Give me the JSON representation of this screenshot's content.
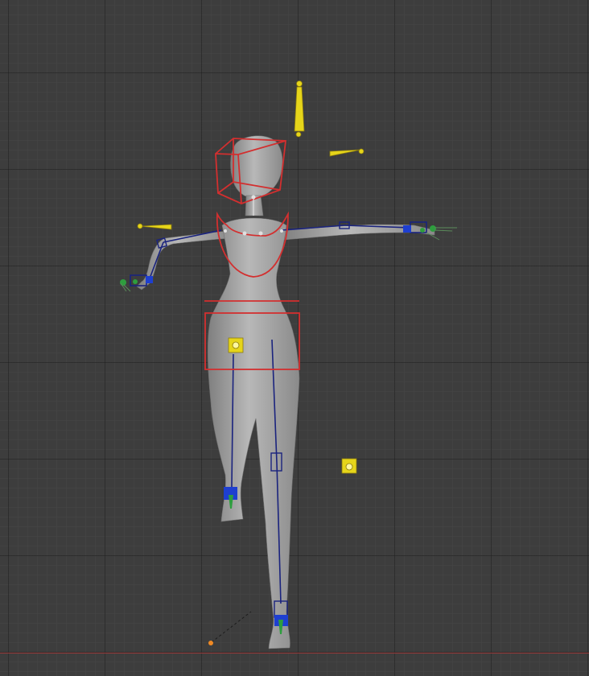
{
  "viewport": {
    "background": "#3d3d3d",
    "grid_minor": "#464646",
    "grid_major": "#2a2a2a",
    "x_axis_color": "#9a3a3a"
  },
  "scene": {
    "mesh_color": "#9a9a9a",
    "bone_color": "#1a237e",
    "control_color": "#d32f2f",
    "target_color": "#e6d51a",
    "ik_color": "#1e3fd0",
    "pole_color": "#2e9e3e",
    "origin_marker_color": "#f08a24"
  },
  "icons": [
    "head-control-icon",
    "pole-target-icon",
    "hand-ik-icon",
    "foot-ik-icon",
    "origin-marker-icon"
  ]
}
